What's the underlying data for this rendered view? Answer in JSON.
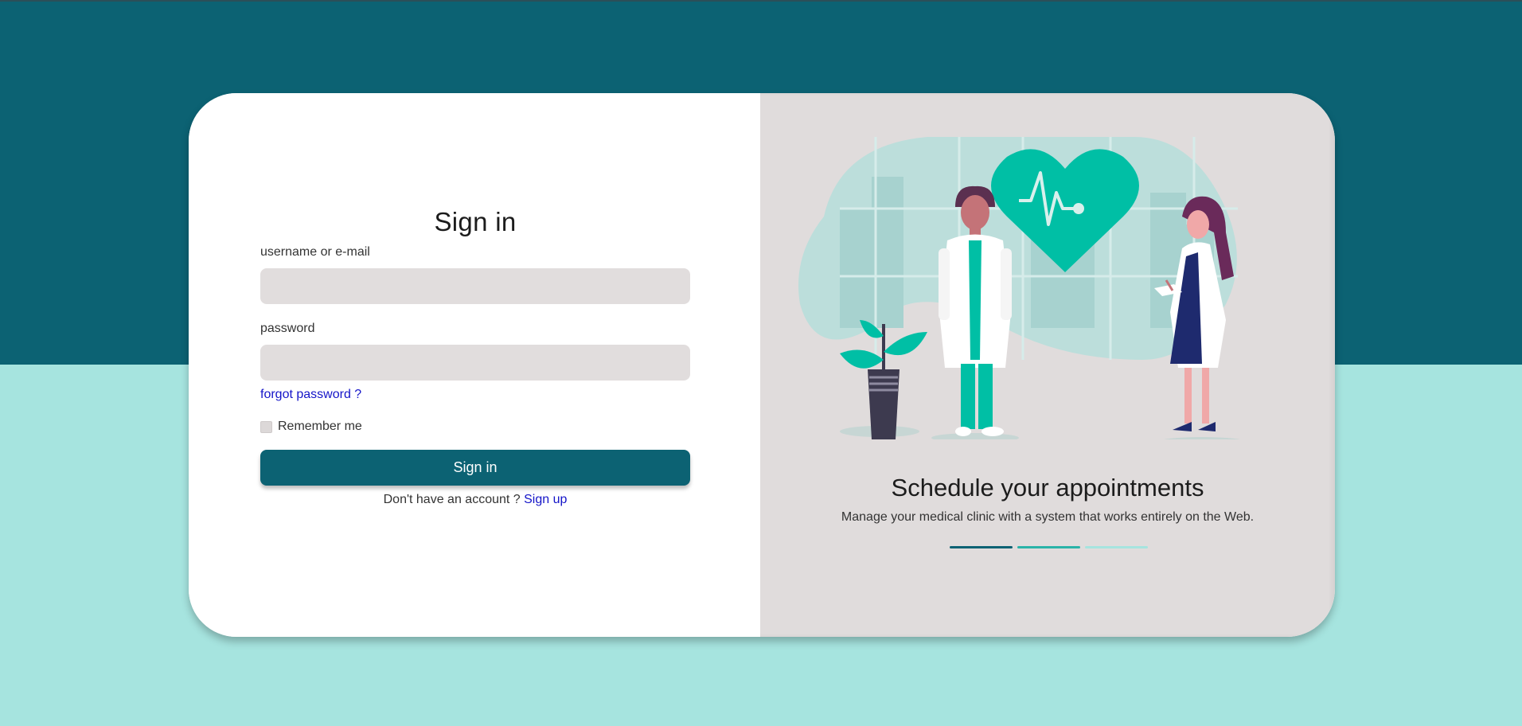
{
  "login": {
    "title": "Sign in",
    "username_label": "username or e-mail",
    "username_value": "",
    "password_label": "password",
    "password_value": "",
    "forgot_link": "forgot password ?",
    "remember_label": "Remember me",
    "remember_checked": false,
    "submit_label": "Sign in",
    "signup_prompt": "Don't have an account ?",
    "signup_link": "Sign up"
  },
  "promo": {
    "title": "Schedule your appointments",
    "subtitle": "Manage your medical clinic with a system that works entirely on the Web.",
    "slides": [
      {
        "color": "#0c6273",
        "active": true
      },
      {
        "color": "#2ab3a8",
        "active": false
      },
      {
        "color": "#a6e4df",
        "active": false
      }
    ],
    "illustration_icons": [
      "heart-pulse-icon",
      "male-doctor-icon",
      "female-doctor-icon",
      "potted-plant-icon"
    ]
  },
  "colors": {
    "primary": "#0c6273",
    "accent": "#00bfa5",
    "background_light": "#a6e4df",
    "input_bg": "#e1dddd",
    "panel_bg": "#e0dcdc",
    "link": "#1414c8"
  }
}
